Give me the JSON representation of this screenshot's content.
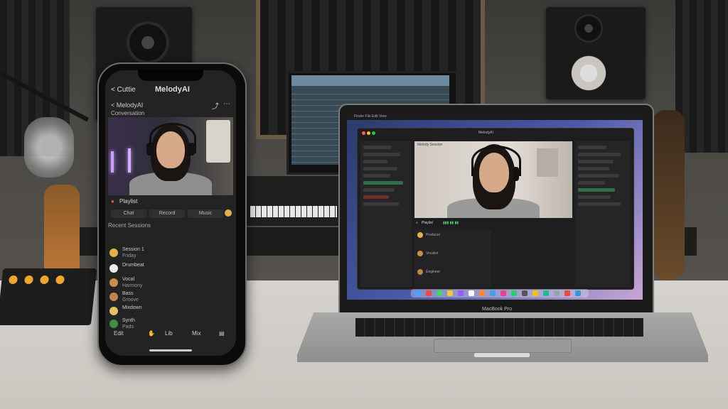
{
  "phone": {
    "back_label": "< Cuttie",
    "title": "MelodyAI",
    "subheader_left": "< MelodyAI",
    "subheader_sub": "Conversation",
    "section_label": "Playlist",
    "tabs": [
      "Chat",
      "Record",
      "Music"
    ],
    "list_caption": "Recent Sessions",
    "items": [
      {
        "title": "Session 1",
        "sub": "Friday"
      },
      {
        "title": "Drumbeat",
        "sub": ""
      },
      {
        "title": "Vocal",
        "sub": "Harmony"
      },
      {
        "title": "Bass",
        "sub": "Groove"
      },
      {
        "title": "Mixdown",
        "sub": ""
      },
      {
        "title": "Synth",
        "sub": "Pads"
      }
    ],
    "tabbar": [
      "Edit",
      "Lib",
      "Mix"
    ],
    "accent_colors": [
      "#e2b24a",
      "#e0a04a",
      "#c98f49",
      "#b88b4a",
      "#e4c066",
      "#3a8f4a"
    ]
  },
  "laptop": {
    "menubar": "Finder  File  Edit  View",
    "window_title": "MelodyAI",
    "video_label": "Melody Session",
    "toolbar_label": "Playlist",
    "chat_items": [
      "Producer",
      "Vocalist",
      "Engineer"
    ],
    "brand_label": "MacBook Pro",
    "dock_colors": [
      "#4aa3ff",
      "#e94b4b",
      "#4bd06a",
      "#f6c443",
      "#9b59f5",
      "#ffffff",
      "#ff8a2b",
      "#3fa0e8",
      "#e84393",
      "#2ecc71",
      "#555555",
      "#f1c40f",
      "#1abc9c",
      "#95a5a6",
      "#e74c3c",
      "#3498db"
    ]
  }
}
